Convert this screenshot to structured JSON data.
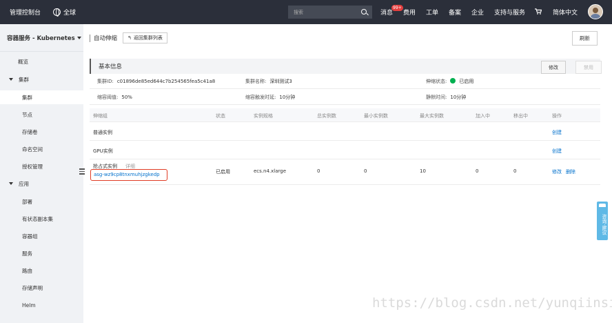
{
  "topbar": {
    "brand": "管理控制台",
    "region": "全球",
    "search_placeholder": "搜索",
    "nav": {
      "messages": "消息",
      "messages_badge": "99+",
      "billing": "费用",
      "tickets": "工单",
      "record": "备案",
      "enterprise": "企业",
      "support": "支持与服务",
      "language": "简体中文"
    }
  },
  "sidebar": {
    "product": "容器服务 - Kubernetes",
    "overview": "概览",
    "cluster_group": "集群",
    "cluster_items": [
      "集群",
      "节点",
      "存储卷",
      "命名空间",
      "授权管理"
    ],
    "app_group": "应用",
    "app_items": [
      "部署",
      "有状态副本集",
      "容器组",
      "服务",
      "路由",
      "存储声明",
      "Helm"
    ]
  },
  "main": {
    "title": "自动伸缩",
    "back_button": "返回集群列表",
    "refresh_button": "刷新",
    "basic_info": {
      "title": "基本信息",
      "edit_button": "修改",
      "disable_button": "禁用",
      "cluster_id_label": "集群ID:",
      "cluster_id": "c01896de85ed644c7b254565fea5c41a8",
      "cluster_name_label": "集群名称:",
      "cluster_name": "深圳测试3",
      "scale_status_label": "伸缩状态:",
      "scale_status": "已启用",
      "threshold_label": "缩容阈值:",
      "threshold": "50%",
      "trigger_delay_label": "缩容触发时延:",
      "trigger_delay": "10分钟",
      "cooldown_label": "静默时间:",
      "cooldown": "10分钟"
    },
    "table": {
      "headers": [
        "伸缩组",
        "状态",
        "实例规格",
        "总实例数",
        "最小实例数",
        "最大实例数",
        "加入中",
        "移出中",
        "操作"
      ],
      "rows": [
        {
          "group": "普通实例",
          "status": "",
          "spec": "",
          "total": "",
          "min": "",
          "max": "",
          "joining": "",
          "removing": "",
          "actions": [
            "创建"
          ]
        },
        {
          "group": "GPU实例",
          "status": "",
          "spec": "",
          "total": "",
          "min": "",
          "max": "",
          "joining": "",
          "removing": "",
          "actions": [
            "创建"
          ]
        },
        {
          "group": "抢占式实例",
          "detail": "详细",
          "asg_id": "asg-wz9cp8tnxmuhjzgkedp",
          "status": "已启用",
          "spec": "ecs.n4.xlarge",
          "total": "0",
          "min": "0",
          "max": "10",
          "joining": "0",
          "removing": "0",
          "actions": [
            "修改",
            "删除"
          ]
        }
      ]
    }
  },
  "feedback": "咨询·建议",
  "watermark": "https://blog.csdn.net/yunqiinsight"
}
